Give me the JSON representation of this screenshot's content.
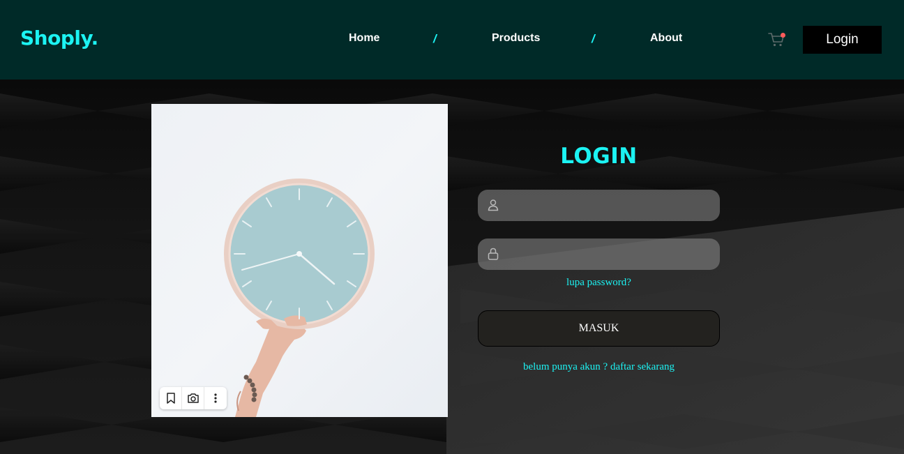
{
  "header": {
    "brand": "Shoply.",
    "nav": [
      {
        "label": "Home"
      },
      {
        "label": "Products"
      },
      {
        "label": "About"
      }
    ],
    "separator": "/",
    "login_label": "Login",
    "cart_icon": "cart-icon",
    "accent_color": "#1cf3f3",
    "background_color": "#002a28"
  },
  "photo": {
    "icon": "wall-clock-photo",
    "tools": [
      "bookmark-icon",
      "camera-search-icon",
      "more-vertical-icon"
    ]
  },
  "login_form": {
    "title": "LOGIN",
    "username": {
      "value": "",
      "placeholder": "",
      "icon": "user-icon"
    },
    "password": {
      "value": "",
      "placeholder": "",
      "icon": "lock-icon"
    },
    "forgot_label": "lupa password?",
    "submit_label": "MASUK",
    "register_label": "belum punya akun ? daftar sekarang"
  }
}
